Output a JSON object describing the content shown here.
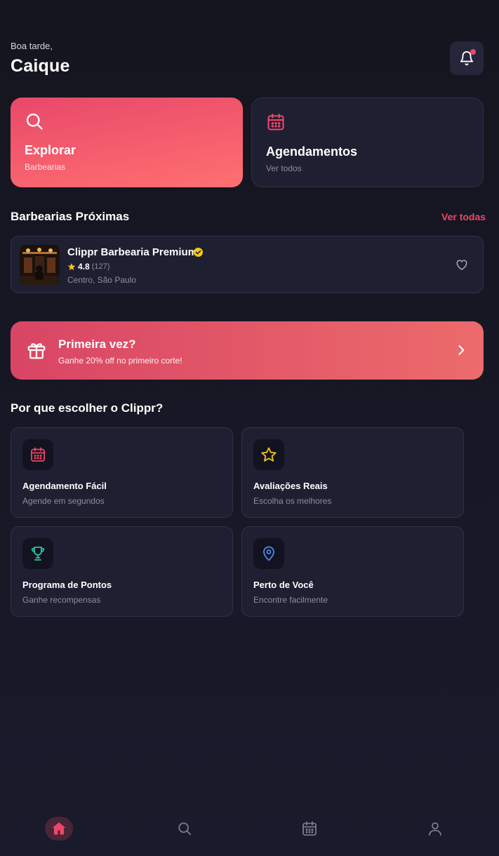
{
  "colors": {
    "accent": "#f0456a",
    "background": "#171724",
    "card": "#1e1f31",
    "muted_text": "#8c8da3",
    "star": "#f5c518",
    "trophy": "#2ec4a0",
    "location": "#4a8cf0"
  },
  "header": {
    "greeting": "Boa tarde,",
    "username": "Caique",
    "notification_icon": "bell-icon"
  },
  "quick_actions": [
    {
      "title": "Explorar",
      "subtitle": "Barbearias",
      "icon": "search-icon"
    },
    {
      "title": "Agendamentos",
      "subtitle": "Ver todos",
      "icon": "calendar-icon"
    }
  ],
  "nearby": {
    "title": "Barbearias Próximas",
    "see_all": "Ver todas",
    "shops": [
      {
        "name": "Clippr Barbearia Premium",
        "rating": "4.8",
        "reviews": "(127)",
        "location": "Centro, São Paulo"
      }
    ]
  },
  "promo": {
    "title": "Primeira vez?",
    "subtitle": "Ganhe 20% off no primeiro corte!",
    "icon": "gift-icon"
  },
  "why": {
    "title": "Por que escolher o Clippr?",
    "features": [
      {
        "title": "Agendamento Fácil",
        "subtitle": "Agende em segundos",
        "icon": "calendar-icon"
      },
      {
        "title": "Avaliações Reais",
        "subtitle": "Escolha os melhores",
        "icon": "star-icon"
      },
      {
        "title": "Programa de Pontos",
        "subtitle": "Ganhe recompensas",
        "icon": "trophy-icon"
      },
      {
        "title": "Perto de Você",
        "subtitle": "Encontre facilmente",
        "icon": "location-pin-icon"
      }
    ]
  },
  "bottom_nav": [
    {
      "icon": "home-icon",
      "active": true
    },
    {
      "icon": "search-icon",
      "active": false
    },
    {
      "icon": "calendar-icon",
      "active": false
    },
    {
      "icon": "user-icon",
      "active": false
    }
  ]
}
